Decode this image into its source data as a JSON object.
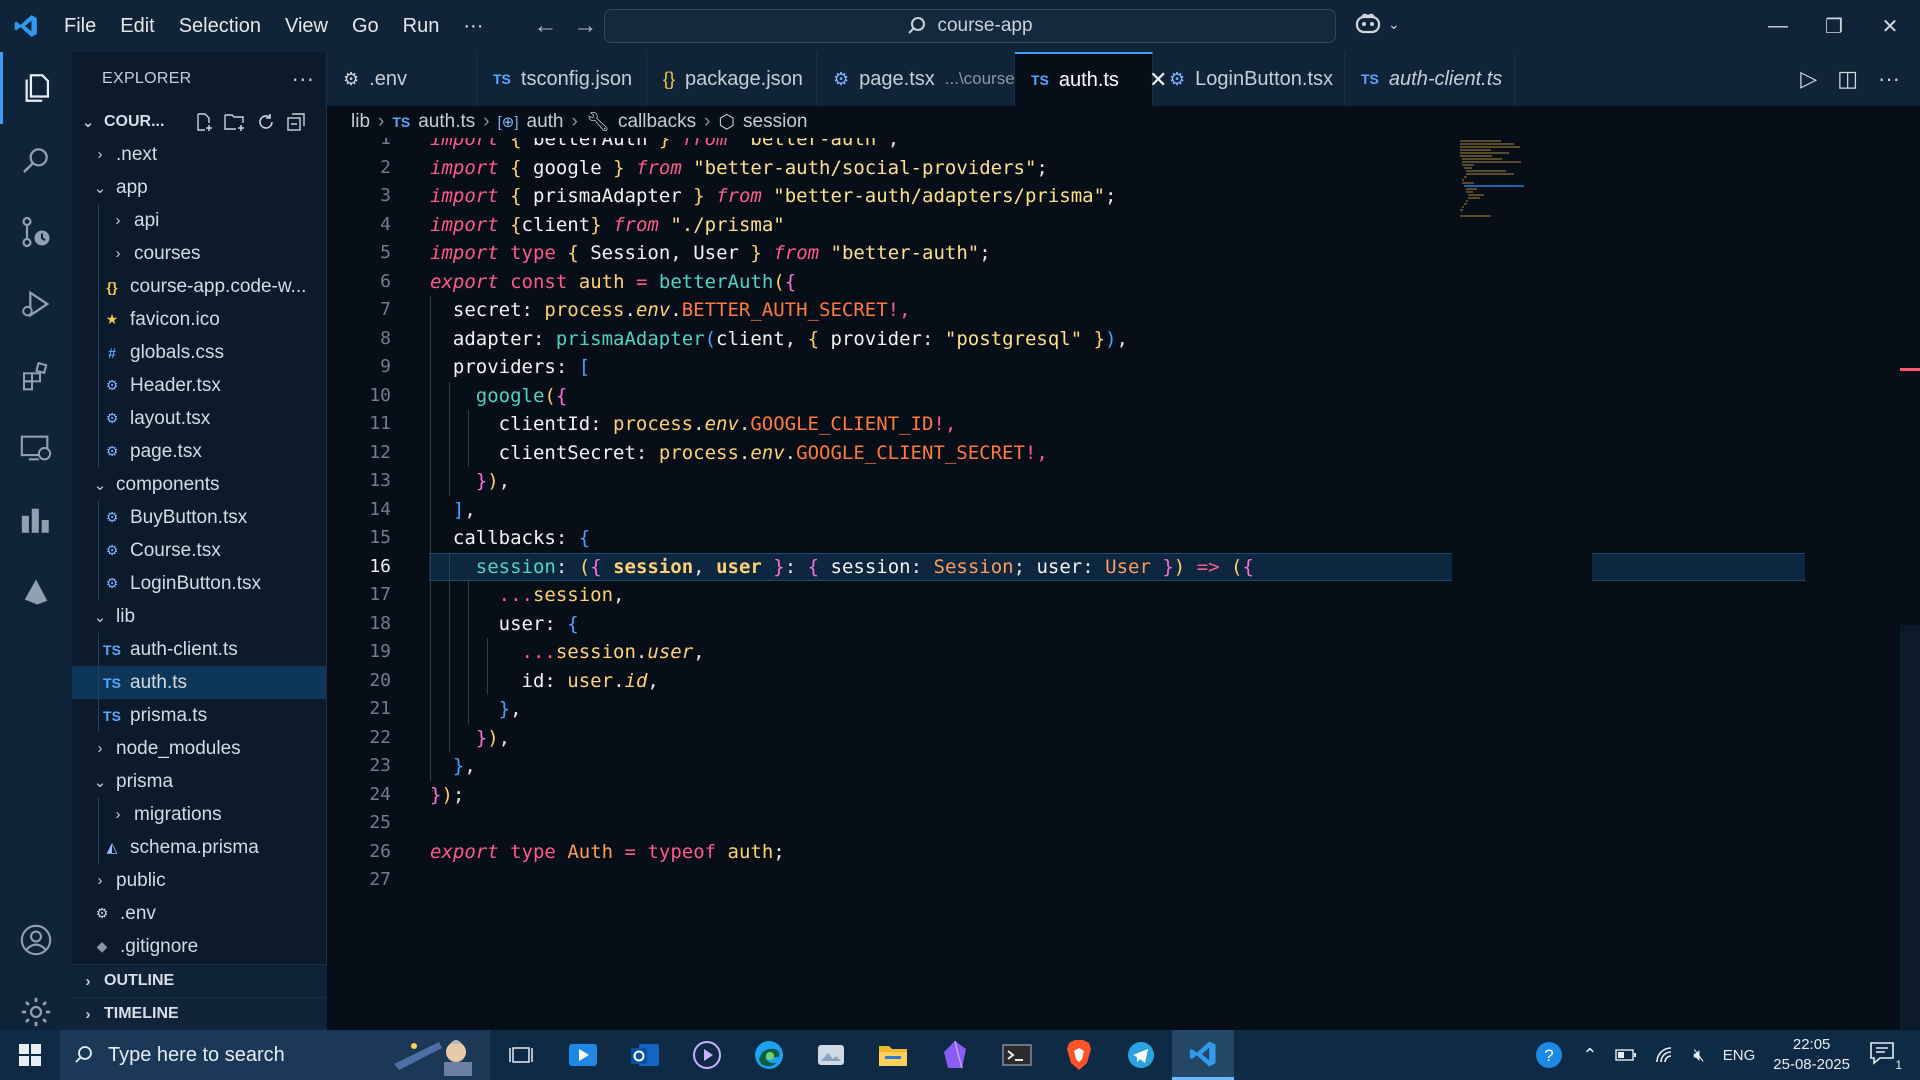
{
  "titlebar": {
    "menu": [
      "File",
      "Edit",
      "Selection",
      "View",
      "Go",
      "Run",
      "···"
    ],
    "search": "course-app"
  },
  "sidebar": {
    "title": "EXPLORER",
    "more": "···",
    "project": "COUR...",
    "items": [
      {
        "label": ".next",
        "depth": 1,
        "type": "folder",
        "open": false
      },
      {
        "label": "app",
        "depth": 1,
        "type": "folder",
        "open": true
      },
      {
        "label": "api",
        "depth": 2,
        "type": "folder",
        "open": false
      },
      {
        "label": "courses",
        "depth": 2,
        "type": "folder",
        "open": false
      },
      {
        "label": "course-app.code-w...",
        "depth": 2,
        "type": "json"
      },
      {
        "label": "favicon.ico",
        "depth": 2,
        "type": "star"
      },
      {
        "label": "globals.css",
        "depth": 2,
        "type": "css"
      },
      {
        "label": "Header.tsx",
        "depth": 2,
        "type": "react"
      },
      {
        "label": "layout.tsx",
        "depth": 2,
        "type": "react"
      },
      {
        "label": "page.tsx",
        "depth": 2,
        "type": "react"
      },
      {
        "label": "components",
        "depth": 1,
        "type": "folder",
        "open": true
      },
      {
        "label": "BuyButton.tsx",
        "depth": 2,
        "type": "react"
      },
      {
        "label": "Course.tsx",
        "depth": 2,
        "type": "react"
      },
      {
        "label": "LoginButton.tsx",
        "depth": 2,
        "type": "react"
      },
      {
        "label": "lib",
        "depth": 1,
        "type": "folder",
        "open": true
      },
      {
        "label": "auth-client.ts",
        "depth": 2,
        "type": "ts"
      },
      {
        "label": "auth.ts",
        "depth": 2,
        "type": "ts",
        "selected": true
      },
      {
        "label": "prisma.ts",
        "depth": 2,
        "type": "ts"
      },
      {
        "label": "node_modules",
        "depth": 1,
        "type": "folder",
        "open": false
      },
      {
        "label": "prisma",
        "depth": 1,
        "type": "folder",
        "open": true
      },
      {
        "label": "migrations",
        "depth": 2,
        "type": "folder",
        "open": false
      },
      {
        "label": "schema.prisma",
        "depth": 2,
        "type": "prisma"
      },
      {
        "label": "public",
        "depth": 1,
        "type": "folder",
        "open": false
      },
      {
        "label": ".env",
        "depth": 1,
        "type": "gear"
      },
      {
        "label": ".gitignore",
        "depth": 1,
        "type": "git"
      }
    ],
    "outline": "OUTLINE",
    "timeline": "TIMELINE"
  },
  "tabs": [
    {
      "label": ".env",
      "icon": "gear"
    },
    {
      "label": "tsconfig.json",
      "icon": "ts"
    },
    {
      "label": "package.json",
      "icon": "json"
    },
    {
      "label": "page.tsx",
      "sub": "...\\courses",
      "icon": "react"
    },
    {
      "label": "auth.ts",
      "icon": "ts",
      "active": true,
      "close": "✕"
    },
    {
      "label": "LoginButton.tsx",
      "icon": "react"
    },
    {
      "label": "auth-client.ts",
      "icon": "ts",
      "italic": true
    }
  ],
  "breadcrumb": [
    "lib",
    "auth.ts",
    "auth",
    "callbacks",
    "session"
  ],
  "editor": {
    "current_line": 16,
    "lines": [
      "import { betterAuth } from \"better-auth\";",
      "import { google } from \"better-auth/social-providers\";",
      "import { prismaAdapter } from \"better-auth/adapters/prisma\";",
      "import {client} from \"./prisma\"",
      "import type { Session, User } from \"better-auth\";",
      "export const auth = betterAuth({",
      "  secret: process.env.BETTER_AUTH_SECRET!,",
      "  adapter: prismaAdapter(client, { provider: \"postgresql\" }),",
      "  providers: [",
      "    google({",
      "      clientId: process.env.GOOGLE_CLIENT_ID!,",
      "      clientSecret: process.env.GOOGLE_CLIENT_SECRET!,",
      "    }),",
      "  ],",
      "  callbacks: {",
      "    session: ({ session, user }: { session: Session; user: User }) => ({",
      "      ...session,",
      "      user: {",
      "        ...session.user,",
      "        id: user.id,",
      "      },",
      "    }),",
      "  },",
      "});",
      "",
      "export type Auth = typeof auth;",
      ""
    ]
  },
  "taskbar": {
    "search_placeholder": "Type here to search",
    "lang": "ENG",
    "time": "22:05",
    "date": "25-08-2025",
    "notifications": "1"
  }
}
